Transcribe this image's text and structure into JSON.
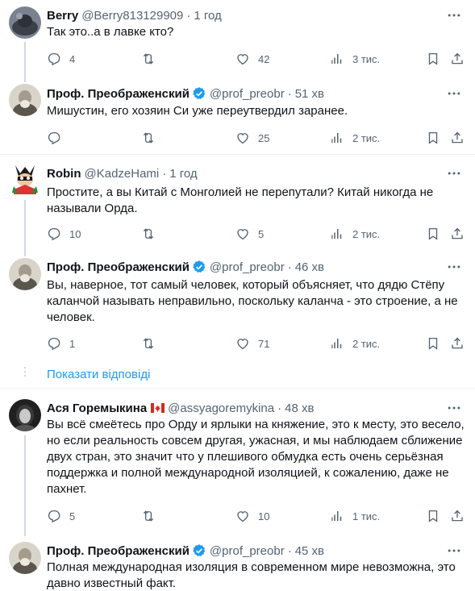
{
  "tweets": [
    {
      "name": "Berry",
      "handle": "@Berry813129909",
      "time": "1 год",
      "text": "Так это..а в лавке кто?",
      "replies": "4",
      "retweets": "",
      "likes": "42",
      "views": "3 тис."
    },
    {
      "name": "Проф. Преображенский",
      "handle": "@prof_preobr",
      "time": "51 хв",
      "text": "Мишустин, его хозяин Си уже переутвердил заранее.",
      "replies": "",
      "retweets": "",
      "likes": "25",
      "views": "2 тис."
    },
    {
      "name": "Robin",
      "handle": "@KadzeHami",
      "time": "1 год",
      "text_lines": [
        "Простите, а вы Китай с Монголией не перепутали? Китай никогда не",
        "называли Орда."
      ],
      "replies": "10",
      "retweets": "",
      "likes": "5",
      "views": "2 тис."
    },
    {
      "name": "Проф. Преображенский",
      "handle": "@prof_preobr",
      "time": "46 хв",
      "text_lines": [
        "Вы, наверное, тот самый человек, который объясняет, что дядю Стёпу",
        "каланчой называть неправильно, поскольку каланча - это строение, а не",
        "человек."
      ],
      "replies": "1",
      "retweets": "",
      "likes": "71",
      "views": "2 тис."
    },
    {
      "name": "Ася Горемыкина",
      "handle": "@assyagoremykina",
      "time": "48 хв",
      "text_lines": [
        "Вы всё смеётесь про Орду и ярлыки на княжение, это к месту, это весело,",
        "но если реальность совсем другая, ужасная, и мы наблюдаем сближение",
        "двух стран, это значит что у плешивого обмудка есть очень серьёзная",
        "поддержка и полной международной изоляцией, к сожалению, даже не",
        "пахнет."
      ],
      "replies": "5",
      "retweets": "",
      "likes": "10",
      "views": "1 тис."
    },
    {
      "name": "Проф. Преображенский",
      "handle": "@prof_preobr",
      "time": "45 хв",
      "text_lines": [
        "Полная международная изоляция в современном мире невозможна, это",
        "давно известный факт."
      ]
    }
  ],
  "show_replies": "Показати відповіді",
  "icons": {
    "reply": "reply-icon",
    "retweet": "retweet-icon",
    "like": "heart-icon",
    "views": "views-icon",
    "bookmark": "bookmark-icon",
    "share": "share-icon",
    "more": "more-icon",
    "verified": "verified-badge-icon",
    "flag": "canada-flag-icon"
  },
  "colors": {
    "link": "#1d9bf0",
    "secondary_text": "#536471",
    "verified": "#1d9bf0",
    "divider": "#eff3f4"
  }
}
